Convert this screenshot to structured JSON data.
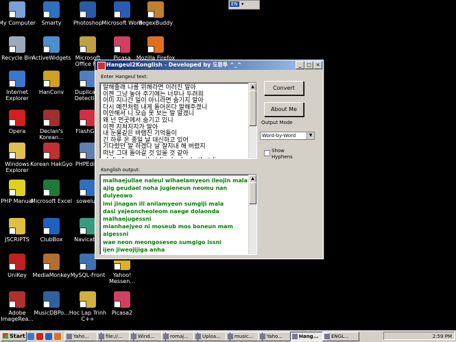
{
  "desktop_icons": [
    {
      "label": "My Computer",
      "color": "#7aa0d8"
    },
    {
      "label": "Smarty",
      "color": "#3070c0"
    },
    {
      "label": "Photoshop",
      "color": "#2a5aa8"
    },
    {
      "label": "Microsoft Word",
      "color": "#2b5bb5"
    },
    {
      "label": "RegexBuddy",
      "color": "#c08030"
    },
    {
      "label": "Recycle Bin",
      "color": "#9aaab8"
    },
    {
      "label": "ActiveWidgets",
      "color": "#4a90d0"
    },
    {
      "label": "Microsoft Office F...",
      "color": "#c0a040"
    },
    {
      "label": "Picasa",
      "color": "#d04060"
    },
    {
      "label": "Mozilla Firefox",
      "color": "#e07020"
    },
    {
      "label": "Internet Explorer",
      "color": "#3a78d0"
    },
    {
      "label": "HanConv",
      "color": "#d0a020"
    },
    {
      "label": "Duplicate Detective",
      "color": "#5080c0"
    },
    {
      "label": "Opera",
      "color": "#d02020"
    },
    {
      "label": "Declan's Korean...",
      "color": "#a03030"
    },
    {
      "label": "FlashGet",
      "color": "#d03040"
    },
    {
      "label": "Windows Explorer",
      "color": "#e0c050"
    },
    {
      "label": "Korean HakGyo",
      "color": "#c03030"
    },
    {
      "label": "PHPEdit2",
      "color": "#6080b0"
    },
    {
      "label": "PHP Manual",
      "color": "#e0d020"
    },
    {
      "label": "Microsoft Excel",
      "color": "#1d7a3a"
    },
    {
      "label": "sowelu.t",
      "color": "#3070c0"
    },
    {
      "label": "JSCRIPTS",
      "color": "#e0c040"
    },
    {
      "label": "ClubBox",
      "color": "#2060c0"
    },
    {
      "label": "Navicat M",
      "color": "#3a9a80"
    },
    {
      "label": "UniKey",
      "color": "#c02020"
    },
    {
      "label": "MediaMonkey",
      "color": "#b07030"
    },
    {
      "label": "MySQL-Front",
      "color": "#4070b0"
    },
    {
      "label": "Yahoo! Messen...",
      "color": "#e0b020"
    },
    {
      "label": "Adobe ImageRea...",
      "color": "#b03030"
    },
    {
      "label": "MusicDBPo...",
      "color": "#3060a0"
    },
    {
      "label": "Hoc Lap Trinh C++",
      "color": "#d0b040"
    },
    {
      "label": "Picasa2",
      "color": "#d04060"
    }
  ],
  "language_bar": {
    "code": "EN",
    "menu": "▾"
  },
  "window": {
    "title": "Hangeul2Konglish - Developed by 도환투 ^_^",
    "controls": {
      "minimize": "_",
      "maximize": "□",
      "close": "✕"
    },
    "input_label": "Enter Hangeul text:",
    "input_lines": [
      "말해줄래 나를 위해라면 이러진 말아",
      "이젠 그냥 놓아 주기에는 너무나 두려워",
      "이미 지나간 일이 아니라면 숨기지 말아",
      "다시 예전처럼 내게 돌아온다 말해주겠니",
      "미안해서 니 모습 못 보는 말 알겠니",
      "왜 넌 먼곳에서 숨기고 있니",
      "이젠 지쳐지지가 말아",
      "내 눈물같은 바램진 기억들이",
      "긴 하루 온 종일 날 대신하고 있어",
      "기다렸던 말 하겠다 날 잘지내 해 버렸지",
      "떠난 그대 돌아갈 것 있을 것 같아",
      "oh lie for you that lie do do do that lie"
    ],
    "convert_button": "Convert",
    "about_button": "About Me",
    "output_mode_label": "Output Mode",
    "output_mode_value": "Word-by-Word",
    "show_hyphens_label": "Show Hyphens",
    "output_label": "Konglish output:",
    "output_lines": [
      "malhaejullae naleul wihaelamyeon ileojin mala",
      "ajig geudael noha jugieneun neomu nan",
      "dulyeowo",
      "imi jinagan ili anilamyeon sumgiji mala",
      "dasi yejeoncheoleom naege dolaonda",
      "malhaejugessni",
      "mianhaejyeo ni moseub mos boneun mam",
      "algessni",
      "wae neon meongoseseo sumgigo issni",
      "ijen jiweojijiga anha"
    ]
  },
  "taskbar": {
    "start_label": "Start",
    "tasks": [
      {
        "label": "Yaho...",
        "active": false
      },
      {
        "label": "file://...",
        "active": false
      },
      {
        "label": "Wind...",
        "active": false
      },
      {
        "label": "romaj...",
        "active": false
      },
      {
        "label": "Uploa...",
        "active": false
      },
      {
        "label": "music...",
        "active": false
      },
      {
        "label": "Yaho...",
        "active": false
      },
      {
        "label": "Hang...",
        "active": true
      },
      {
        "label": "ENGL...",
        "active": false
      }
    ],
    "clock": "2:59 PM"
  }
}
